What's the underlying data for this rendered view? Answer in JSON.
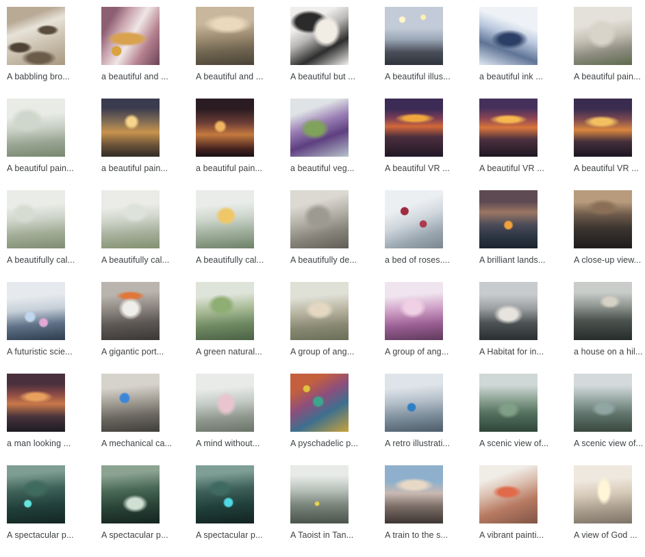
{
  "gallery": {
    "columns": 7,
    "rows": 6,
    "thumbnail_size_px": 85,
    "background_color": "#ffffff",
    "caption_color": "#3c4043",
    "items": [
      {
        "caption": "A babbling bro...",
        "art": "t-brook"
      },
      {
        "caption": "a beautiful and ...",
        "art": "t-brass"
      },
      {
        "caption": "A beautiful and ...",
        "art": "t-street"
      },
      {
        "caption": "A beautiful but ...",
        "art": "t-medusa"
      },
      {
        "caption": "A beautiful illus...",
        "art": "t-illus"
      },
      {
        "caption": "a beautiful ink ...",
        "art": "t-ink"
      },
      {
        "caption": "A beautiful pain...",
        "art": "t-castle1"
      },
      {
        "caption": "A beautiful pain...",
        "art": "t-tree"
      },
      {
        "caption": "a beautiful pain...",
        "art": "t-palm"
      },
      {
        "caption": "a beautiful pain...",
        "art": "t-fire"
      },
      {
        "caption": "a beautiful veg...",
        "art": "t-veg"
      },
      {
        "caption": "A beautiful VR ...",
        "art": "t-vr1"
      },
      {
        "caption": "A beautiful VR ...",
        "art": "t-vr2"
      },
      {
        "caption": "A beautiful VR ...",
        "art": "t-vr3"
      },
      {
        "caption": "A beautifully cal...",
        "art": "t-cal1"
      },
      {
        "caption": "A beautifully cal...",
        "art": "t-cal2"
      },
      {
        "caption": "A beautifully cal...",
        "art": "t-cal3"
      },
      {
        "caption": "A beautifully de...",
        "art": "t-stone"
      },
      {
        "caption": "a bed of roses....",
        "art": "t-roses"
      },
      {
        "caption": "A brilliant lands...",
        "art": "t-brill"
      },
      {
        "caption": "A close-up view...",
        "art": "t-closeup"
      },
      {
        "caption": "A futuristic scie...",
        "art": "t-sci"
      },
      {
        "caption": "A gigantic port...",
        "art": "t-portal"
      },
      {
        "caption": "A green natural...",
        "art": "t-green"
      },
      {
        "caption": "A group of ang...",
        "art": "t-ang1"
      },
      {
        "caption": "A group of ang...",
        "art": "t-ang2"
      },
      {
        "caption": "A Habitat for in...",
        "art": "t-habitat"
      },
      {
        "caption": "a house on a hil...",
        "art": "t-house"
      },
      {
        "caption": "a man looking ...",
        "art": "t-man"
      },
      {
        "caption": "A mechanical ca...",
        "art": "t-mech"
      },
      {
        "caption": "A mind without...",
        "art": "t-mind"
      },
      {
        "caption": "A pyschadelic p...",
        "art": "t-psych"
      },
      {
        "caption": "A retro illustrati...",
        "art": "t-retro"
      },
      {
        "caption": "A scenic view of...",
        "art": "t-scenic1"
      },
      {
        "caption": "A scenic view of...",
        "art": "t-scenic2"
      },
      {
        "caption": "A spectacular p...",
        "art": "t-spec1"
      },
      {
        "caption": "A spectacular p...",
        "art": "t-spec2"
      },
      {
        "caption": "A spectacular p...",
        "art": "t-spec3"
      },
      {
        "caption": "A Taoist in Tan...",
        "art": "t-taoist"
      },
      {
        "caption": "A train to the s...",
        "art": "t-train"
      },
      {
        "caption": "A vibrant painti...",
        "art": "t-vibrant"
      },
      {
        "caption": "A view of God ...",
        "art": "t-god"
      }
    ]
  }
}
